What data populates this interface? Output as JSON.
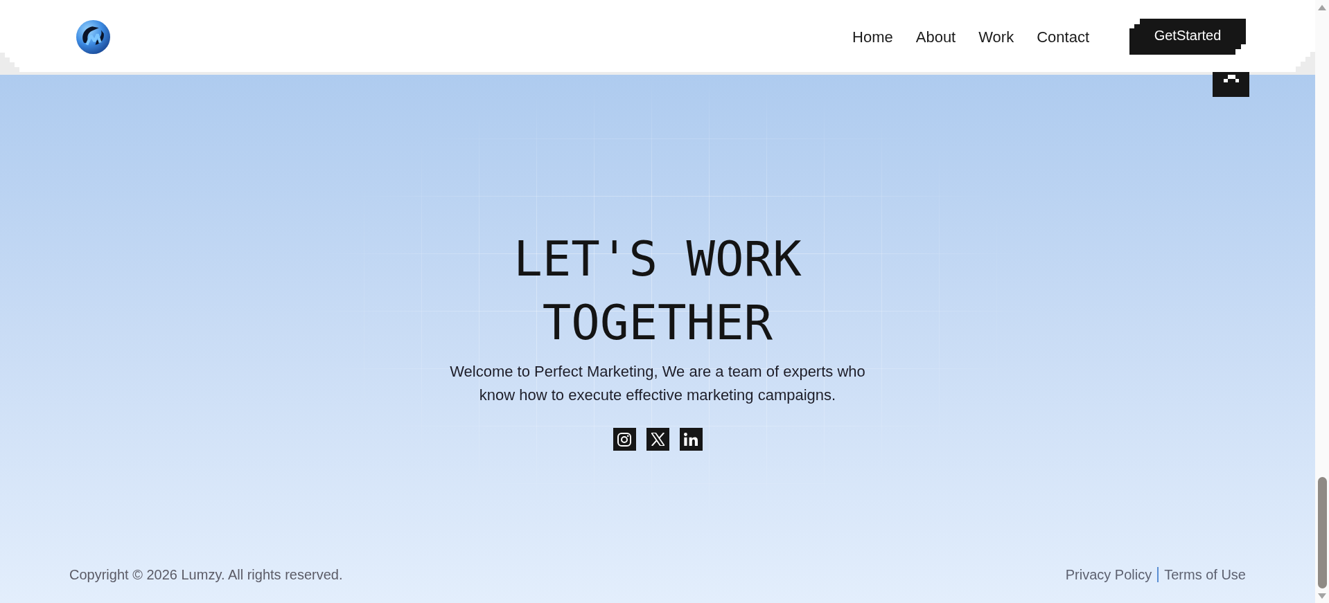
{
  "nav": [
    {
      "label": "Home"
    },
    {
      "label": "About"
    },
    {
      "label": "Work"
    },
    {
      "label": "Contact"
    }
  ],
  "cta_button": {
    "label": "GetStarted"
  },
  "hero": {
    "title": "LET'S WORK TOGETHER",
    "text": "Welcome to Perfect Marketing, We are a team of experts who know how to execute effective marketing campaigns.",
    "social_links": [
      {
        "kind": "instagram"
      },
      {
        "kind": "x"
      },
      {
        "kind": "linkedin"
      }
    ]
  },
  "footer": {
    "copyright": "Copyright © 2026 Lumzy. All rights reserved.",
    "links": [
      "Privacy Policy",
      "Terms of Use"
    ]
  }
}
